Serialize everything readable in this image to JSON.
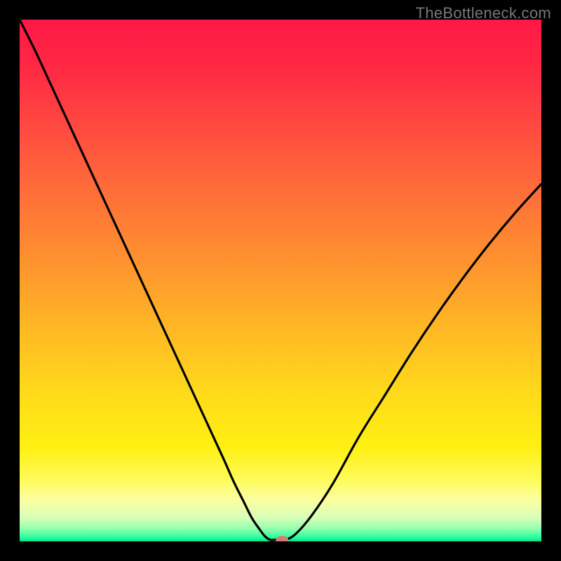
{
  "watermark": "TheBottleneck.com",
  "chart_data": {
    "type": "line",
    "title": "",
    "xlabel": "",
    "ylabel": "",
    "xlim": [
      0,
      100
    ],
    "ylim": [
      0,
      100
    ],
    "series": [
      {
        "name": "curve",
        "x": [
          0,
          3,
          6,
          9,
          12,
          15,
          18,
          21,
          24,
          27,
          30,
          33,
          36,
          39,
          41,
          43,
          44.5,
          46,
          47,
          48,
          49,
          50,
          51,
          53,
          56,
          60,
          65,
          70,
          75,
          80,
          85,
          90,
          95,
          100
        ],
        "y": [
          100,
          94,
          87.5,
          81,
          74.5,
          68,
          61.5,
          55,
          48.5,
          42,
          35.5,
          29,
          22.5,
          16,
          11.5,
          7.5,
          4.5,
          2.3,
          1.0,
          0.3,
          0.3,
          0.3,
          0.3,
          1.5,
          5,
          11,
          20,
          28,
          36,
          43.5,
          50.5,
          57,
          63,
          68.5
        ]
      }
    ],
    "flat_segment": {
      "x_start": 47,
      "x_end": 51,
      "y": 0.3
    },
    "marker": {
      "x": 50.3,
      "y": 0.3
    },
    "gradient_stops": [
      {
        "offset": 0.0,
        "color": "#ff1846"
      },
      {
        "offset": 0.1,
        "color": "#ff2b44"
      },
      {
        "offset": 0.22,
        "color": "#ff4e3f"
      },
      {
        "offset": 0.35,
        "color": "#ff7337"
      },
      {
        "offset": 0.48,
        "color": "#ff972e"
      },
      {
        "offset": 0.6,
        "color": "#ffba24"
      },
      {
        "offset": 0.72,
        "color": "#ffdb1a"
      },
      {
        "offset": 0.82,
        "color": "#fff012"
      },
      {
        "offset": 0.88,
        "color": "#fffb58"
      },
      {
        "offset": 0.92,
        "color": "#fbffa0"
      },
      {
        "offset": 0.955,
        "color": "#d8ffb8"
      },
      {
        "offset": 0.975,
        "color": "#96ffb0"
      },
      {
        "offset": 0.99,
        "color": "#3cffa0"
      },
      {
        "offset": 1.0,
        "color": "#00e988"
      }
    ]
  }
}
